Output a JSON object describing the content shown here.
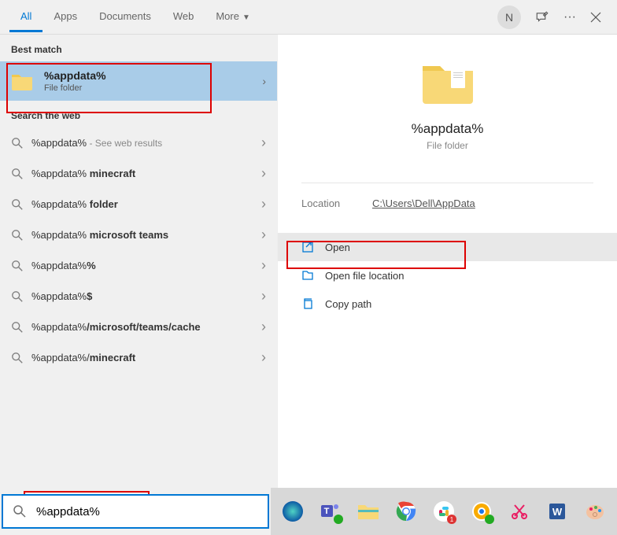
{
  "tabs": [
    {
      "label": "All",
      "active": true
    },
    {
      "label": "Apps",
      "active": false
    },
    {
      "label": "Documents",
      "active": false
    },
    {
      "label": "Web",
      "active": false
    },
    {
      "label": "More",
      "active": false,
      "dropdown": true
    }
  ],
  "avatar_initial": "N",
  "sections": {
    "best_match": "Best match",
    "search_web": "Search the web"
  },
  "best_match": {
    "title": "%appdata%",
    "subtitle": "File folder"
  },
  "web_results": [
    {
      "prefix": "%appdata%",
      "suffix": "",
      "hint": " - See web results"
    },
    {
      "prefix": "%appdata% ",
      "suffix": "minecraft",
      "hint": ""
    },
    {
      "prefix": "%appdata% ",
      "suffix": "folder",
      "hint": ""
    },
    {
      "prefix": "%appdata% ",
      "suffix": "microsoft teams",
      "hint": ""
    },
    {
      "prefix": "%appdata%",
      "suffix": "%",
      "hint": ""
    },
    {
      "prefix": "%appdata%",
      "suffix": "$",
      "hint": ""
    },
    {
      "prefix": "%appdata%",
      "suffix": "/microsoft/teams/cache",
      "hint": ""
    },
    {
      "prefix": "%appdata%/",
      "suffix": "minecraft",
      "hint": ""
    }
  ],
  "preview": {
    "title": "%appdata%",
    "subtitle": "File folder",
    "location_label": "Location",
    "location_path": "C:\\Users\\Dell\\AppData"
  },
  "actions": [
    {
      "icon": "open",
      "label": "Open",
      "hover": true
    },
    {
      "icon": "location",
      "label": "Open file location",
      "hover": false
    },
    {
      "icon": "copy",
      "label": "Copy path",
      "hover": false
    }
  ],
  "search_input": "%appdata%"
}
